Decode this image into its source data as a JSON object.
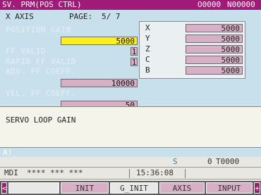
{
  "header": {
    "title": "SV. PRM(POS CTRL)",
    "program": "O0000",
    "sequence": "N00000"
  },
  "page_info": {
    "axis_label": "X  AXIS",
    "page_label": "PAGE:",
    "page": "5/ 7"
  },
  "params": {
    "position_gain": {
      "label": "POSITION GAIN",
      "value": "5000"
    },
    "ff_valid": {
      "label": "FF VALID",
      "value": "1"
    },
    "rapid_ff_valid": {
      "label": "RAPID FF VALID",
      "value": "1"
    },
    "adv_ff_coeff": {
      "label": "ADV. FF COEFF.",
      "value": "10000"
    },
    "vel_ff_coeff": {
      "label": "VEL. FF COEFF.",
      "value": "50"
    }
  },
  "axis_popup": {
    "rows": [
      {
        "axis": "X",
        "value": "5000"
      },
      {
        "axis": "Y",
        "value": "5000"
      },
      {
        "axis": "Z",
        "value": "5000"
      },
      {
        "axis": "C",
        "value": "5000"
      },
      {
        "axis": "B",
        "value": "5000"
      }
    ]
  },
  "message": {
    "text": "SERVO LOOP GAIN"
  },
  "input_line": {
    "prompt": "A)_"
  },
  "status": {
    "s_label": "S",
    "s_value": "0",
    "t_value": "T0000",
    "mode": "MDI",
    "state": "**** *** ***",
    "time": "15:36:08"
  },
  "softkeys": {
    "left_arrow": "<",
    "right_arrow": "+",
    "keys": [
      "",
      "INIT",
      "G_INIT",
      "AXIS",
      "INPUT"
    ]
  },
  "colors": {
    "title_bg": "#a01a78",
    "panel_bg": "#c8e0ec",
    "field_bg": "#d7b0c6",
    "active_field": "#ffee20"
  }
}
